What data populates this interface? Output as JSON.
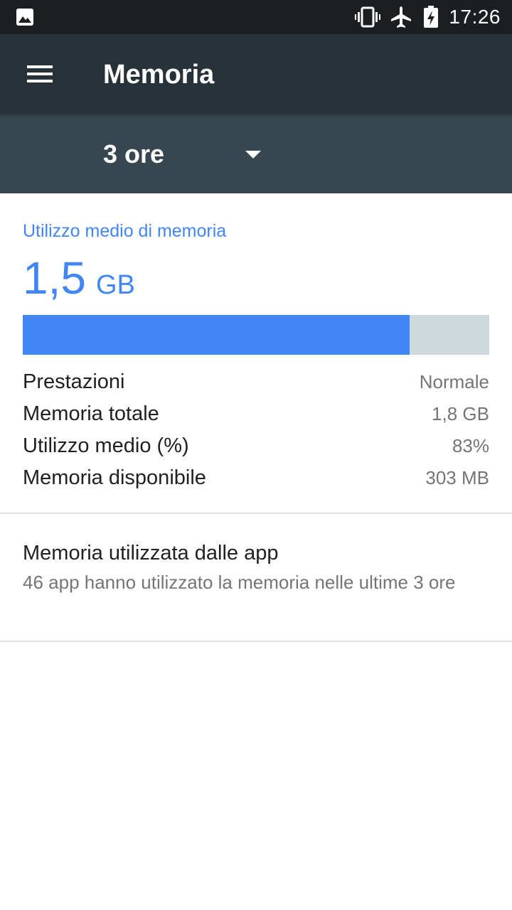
{
  "status_bar": {
    "time": "17:26",
    "icons": [
      "image-notification-icon",
      "vibrate-icon",
      "airplane-mode-icon",
      "battery-charging-icon"
    ]
  },
  "toolbar": {
    "menu_icon": "menu-icon",
    "title": "Memoria"
  },
  "period_selector": {
    "selected": "3 ore",
    "icon": "dropdown-arrow-icon"
  },
  "memory_summary": {
    "label": "Utilizzo medio di memoria",
    "average_value": "1,5",
    "average_unit": "GB",
    "usage_fraction": 0.83
  },
  "stats": [
    {
      "label": "Prestazioni",
      "value": "Normale"
    },
    {
      "label": "Memoria totale",
      "value": "1,8 GB"
    },
    {
      "label": "Utilizzo medio (%)",
      "value": "83%"
    },
    {
      "label": "Memoria disponibile",
      "value": "303 MB"
    }
  ],
  "apps_memory": {
    "title": "Memoria utilizzata dalle app",
    "summary": "46 app hanno utilizzato la memoria nelle ultime 3 ore"
  },
  "colors": {
    "accent": "#4285f4",
    "toolbar": "#263238",
    "spinner_bar": "#37474f",
    "status_bar": "#1b1f22",
    "bar_track": "#cfd8dc"
  }
}
